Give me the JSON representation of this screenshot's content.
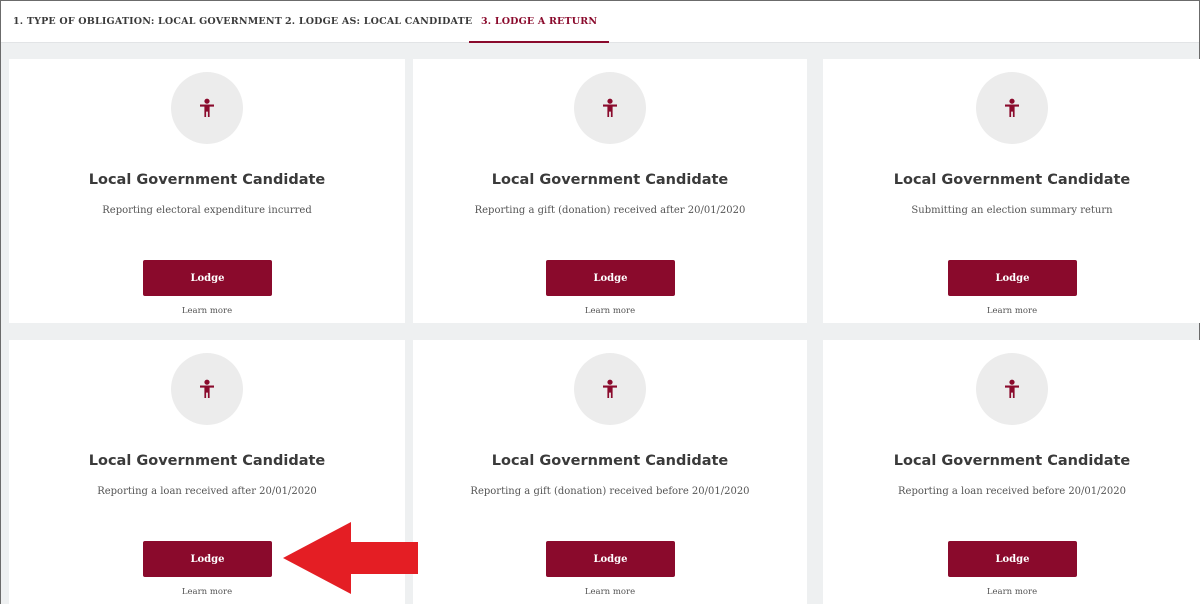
{
  "tabs": [
    {
      "label": "1. TYPE OF OBLIGATION: LOCAL GOVERNMENT"
    },
    {
      "label": "2. LODGE AS: LOCAL CANDIDATE"
    },
    {
      "label": "3. LODGE A RETURN"
    }
  ],
  "active_tab": 2,
  "colors": {
    "accent": "#8a0a2c",
    "annotation_arrow": "#e41e24"
  },
  "cards": [
    {
      "icon": "person-icon",
      "title": "Local Government Candidate",
      "description": "Reporting electoral expenditure incurred",
      "button": "Lodge",
      "link": "Learn more"
    },
    {
      "icon": "person-icon",
      "title": "Local Government Candidate",
      "description": "Reporting a gift (donation) received after 20/01/2020",
      "button": "Lodge",
      "link": "Learn more"
    },
    {
      "icon": "person-icon",
      "title": "Local Government Candidate",
      "description": "Submitting an election summary return",
      "button": "Lodge",
      "link": "Learn more"
    },
    {
      "icon": "person-icon",
      "title": "Local Government Candidate",
      "description": "Reporting a loan received after 20/01/2020",
      "button": "Lodge",
      "link": "Learn more"
    },
    {
      "icon": "person-icon",
      "title": "Local Government Candidate",
      "description": "Reporting a gift (donation) received before 20/01/2020",
      "button": "Lodge",
      "link": "Learn more"
    },
    {
      "icon": "person-icon",
      "title": "Local Government Candidate",
      "description": "Reporting a loan received before 20/01/2020",
      "button": "Lodge",
      "link": "Learn more"
    }
  ]
}
